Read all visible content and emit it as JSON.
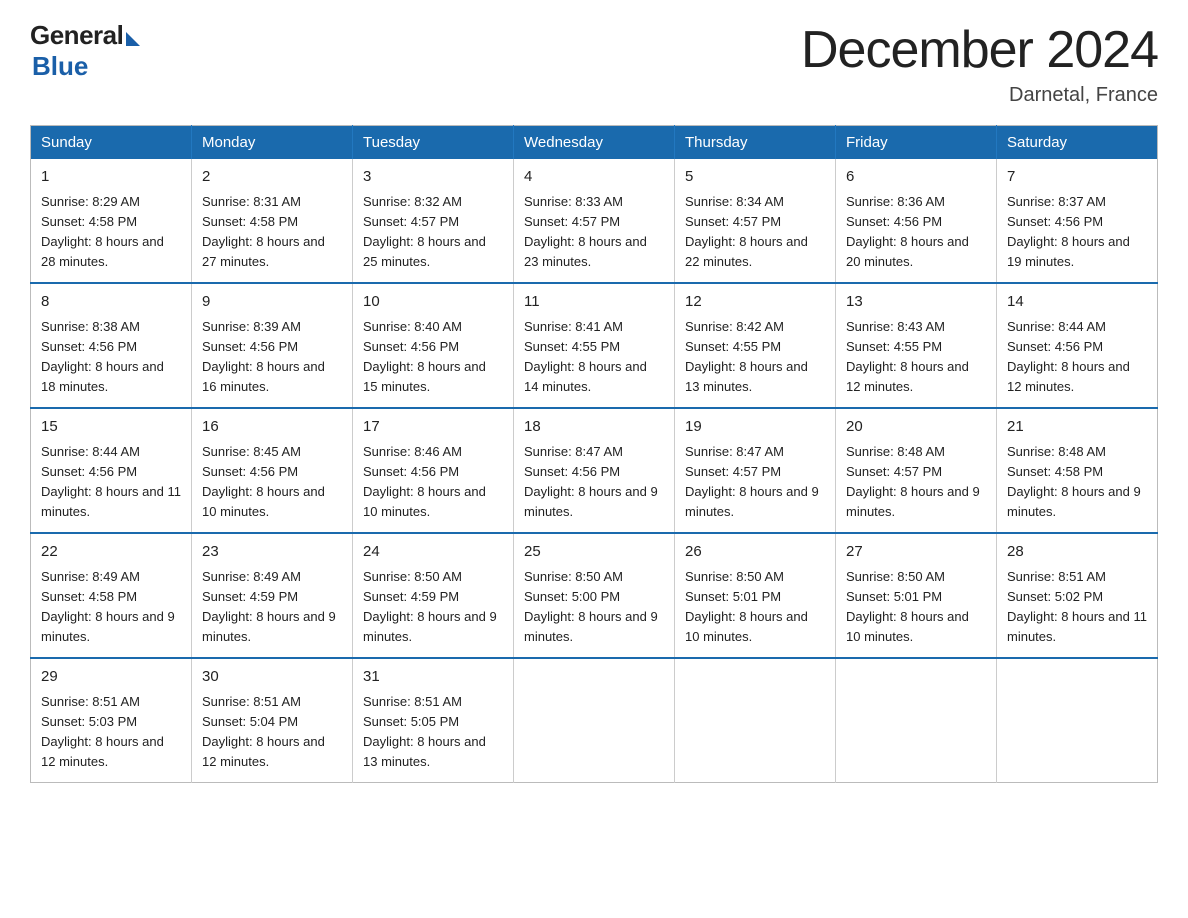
{
  "header": {
    "logo_general": "General",
    "logo_blue": "Blue",
    "title": "December 2024",
    "location": "Darnetal, France"
  },
  "calendar": {
    "days_of_week": [
      "Sunday",
      "Monday",
      "Tuesday",
      "Wednesday",
      "Thursday",
      "Friday",
      "Saturday"
    ],
    "weeks": [
      [
        {
          "day": "1",
          "sunrise": "8:29 AM",
          "sunset": "4:58 PM",
          "daylight": "8 hours and 28 minutes."
        },
        {
          "day": "2",
          "sunrise": "8:31 AM",
          "sunset": "4:58 PM",
          "daylight": "8 hours and 27 minutes."
        },
        {
          "day": "3",
          "sunrise": "8:32 AM",
          "sunset": "4:57 PM",
          "daylight": "8 hours and 25 minutes."
        },
        {
          "day": "4",
          "sunrise": "8:33 AM",
          "sunset": "4:57 PM",
          "daylight": "8 hours and 23 minutes."
        },
        {
          "day": "5",
          "sunrise": "8:34 AM",
          "sunset": "4:57 PM",
          "daylight": "8 hours and 22 minutes."
        },
        {
          "day": "6",
          "sunrise": "8:36 AM",
          "sunset": "4:56 PM",
          "daylight": "8 hours and 20 minutes."
        },
        {
          "day": "7",
          "sunrise": "8:37 AM",
          "sunset": "4:56 PM",
          "daylight": "8 hours and 19 minutes."
        }
      ],
      [
        {
          "day": "8",
          "sunrise": "8:38 AM",
          "sunset": "4:56 PM",
          "daylight": "8 hours and 18 minutes."
        },
        {
          "day": "9",
          "sunrise": "8:39 AM",
          "sunset": "4:56 PM",
          "daylight": "8 hours and 16 minutes."
        },
        {
          "day": "10",
          "sunrise": "8:40 AM",
          "sunset": "4:56 PM",
          "daylight": "8 hours and 15 minutes."
        },
        {
          "day": "11",
          "sunrise": "8:41 AM",
          "sunset": "4:55 PM",
          "daylight": "8 hours and 14 minutes."
        },
        {
          "day": "12",
          "sunrise": "8:42 AM",
          "sunset": "4:55 PM",
          "daylight": "8 hours and 13 minutes."
        },
        {
          "day": "13",
          "sunrise": "8:43 AM",
          "sunset": "4:55 PM",
          "daylight": "8 hours and 12 minutes."
        },
        {
          "day": "14",
          "sunrise": "8:44 AM",
          "sunset": "4:56 PM",
          "daylight": "8 hours and 12 minutes."
        }
      ],
      [
        {
          "day": "15",
          "sunrise": "8:44 AM",
          "sunset": "4:56 PM",
          "daylight": "8 hours and 11 minutes."
        },
        {
          "day": "16",
          "sunrise": "8:45 AM",
          "sunset": "4:56 PM",
          "daylight": "8 hours and 10 minutes."
        },
        {
          "day": "17",
          "sunrise": "8:46 AM",
          "sunset": "4:56 PM",
          "daylight": "8 hours and 10 minutes."
        },
        {
          "day": "18",
          "sunrise": "8:47 AM",
          "sunset": "4:56 PM",
          "daylight": "8 hours and 9 minutes."
        },
        {
          "day": "19",
          "sunrise": "8:47 AM",
          "sunset": "4:57 PM",
          "daylight": "8 hours and 9 minutes."
        },
        {
          "day": "20",
          "sunrise": "8:48 AM",
          "sunset": "4:57 PM",
          "daylight": "8 hours and 9 minutes."
        },
        {
          "day": "21",
          "sunrise": "8:48 AM",
          "sunset": "4:58 PM",
          "daylight": "8 hours and 9 minutes."
        }
      ],
      [
        {
          "day": "22",
          "sunrise": "8:49 AM",
          "sunset": "4:58 PM",
          "daylight": "8 hours and 9 minutes."
        },
        {
          "day": "23",
          "sunrise": "8:49 AM",
          "sunset": "4:59 PM",
          "daylight": "8 hours and 9 minutes."
        },
        {
          "day": "24",
          "sunrise": "8:50 AM",
          "sunset": "4:59 PM",
          "daylight": "8 hours and 9 minutes."
        },
        {
          "day": "25",
          "sunrise": "8:50 AM",
          "sunset": "5:00 PM",
          "daylight": "8 hours and 9 minutes."
        },
        {
          "day": "26",
          "sunrise": "8:50 AM",
          "sunset": "5:01 PM",
          "daylight": "8 hours and 10 minutes."
        },
        {
          "day": "27",
          "sunrise": "8:50 AM",
          "sunset": "5:01 PM",
          "daylight": "8 hours and 10 minutes."
        },
        {
          "day": "28",
          "sunrise": "8:51 AM",
          "sunset": "5:02 PM",
          "daylight": "8 hours and 11 minutes."
        }
      ],
      [
        {
          "day": "29",
          "sunrise": "8:51 AM",
          "sunset": "5:03 PM",
          "daylight": "8 hours and 12 minutes."
        },
        {
          "day": "30",
          "sunrise": "8:51 AM",
          "sunset": "5:04 PM",
          "daylight": "8 hours and 12 minutes."
        },
        {
          "day": "31",
          "sunrise": "8:51 AM",
          "sunset": "5:05 PM",
          "daylight": "8 hours and 13 minutes."
        },
        null,
        null,
        null,
        null
      ]
    ]
  }
}
